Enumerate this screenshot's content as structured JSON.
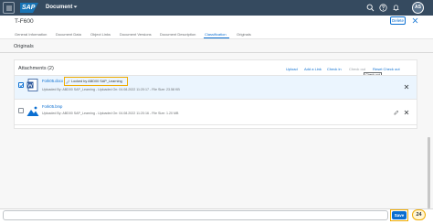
{
  "shell": {
    "app_title": "Document",
    "avatar_initials": "AS",
    "brand": "SAP"
  },
  "header": {
    "object_title": "T-F600",
    "delete_label": "Delete"
  },
  "tabs": [
    {
      "label": "General Information"
    },
    {
      "label": "Document Data"
    },
    {
      "label": "Object Links"
    },
    {
      "label": "Document Versions"
    },
    {
      "label": "Document Description"
    },
    {
      "label": "Classification"
    },
    {
      "label": "Originals"
    }
  ],
  "originals": {
    "section_title": "Originals",
    "attachments_title": "Attachments (2)",
    "toolbar": {
      "upload": "Upload",
      "add_link": "Add a Link",
      "check_in": "Check in",
      "check_out": "Check out",
      "reset_check_out": "Reset Check out"
    },
    "tooltip": "Check out",
    "rows": [
      {
        "name": "Fork05.docx",
        "locked": "Locked by ABD00 SAP_Learning",
        "meta": "Uploaded By: ABD00 SAP_Learning - Uploaded On: 04.08.2022 11:20:17 - File Size: 23.58 KB",
        "selected": true
      },
      {
        "name": "Fork05.bmp",
        "locked": "",
        "meta": "Uploaded By: ABD00 SAP_Learning - Uploaded On: 04.08.2022 11:20:16 - File Size: 1.20 MB",
        "selected": false
      }
    ]
  },
  "footer": {
    "save_label": "Save",
    "step_number": "24"
  },
  "colors": {
    "shell": "#354a5f",
    "accent": "#0a6ed1",
    "highlight": "#f0ab00"
  }
}
